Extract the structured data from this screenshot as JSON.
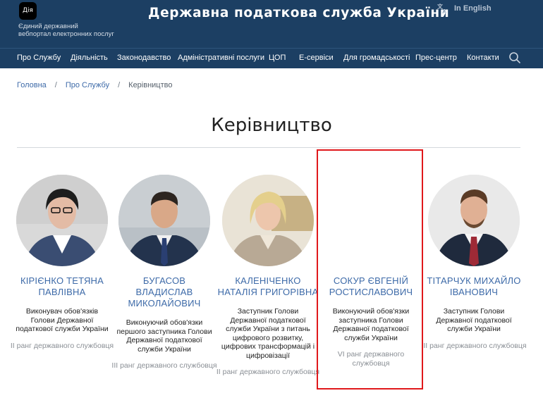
{
  "header": {
    "diia_logo": "Дія",
    "diia_line1": "Єдиний державний",
    "diia_line2": "вебпортал електронних послуг",
    "title": "Державна податкова служба України",
    "lang_link": "In English"
  },
  "nav": {
    "items": [
      {
        "label": "Про Службу"
      },
      {
        "label": "Діяльність"
      },
      {
        "label": "Законодавство"
      },
      {
        "label": "Адміністративні послуги"
      },
      {
        "label": "ЦОП"
      },
      {
        "label": "Е-сервіси"
      },
      {
        "label": "Для громадськості"
      },
      {
        "label": "Прес-центр"
      },
      {
        "label": "Контакти"
      }
    ]
  },
  "breadcrumb": {
    "items": [
      "Головна",
      "Про Службу"
    ],
    "separator": "/",
    "current": "Керівництво"
  },
  "page": {
    "title": "Керівництво"
  },
  "people": [
    {
      "name_line1": "КІРІЄНКО ТЕТЯНА",
      "name_line2": "ПАВЛІВНА",
      "name_line3": "",
      "role": "Виконувач обов'язків Голови Державної податкової служби України",
      "rank": "ІІ ранг державного службовця"
    },
    {
      "name_line1": "БУГАСОВ",
      "name_line2": "ВЛАДИСЛАВ",
      "name_line3": "МИКОЛАЙОВИЧ",
      "role": "Виконуючий обов'язки першого заступника Голови Державної податкової служби України",
      "rank": "ІІІ ранг державного службовця"
    },
    {
      "name_line1": "КАЛЕНІЧЕНКО",
      "name_line2": "НАТАЛІЯ ГРИГОРІВНА",
      "name_line3": "",
      "role": "Заступник Голови Державної податкової служби України з питань цифрового розвитку, цифрових трансформацій і цифровізації",
      "rank": "ІІ ранг державного службовця"
    },
    {
      "name_line1": "СОКУР ЄВГЕНІЙ",
      "name_line2": "РОСТИСЛАВОВИЧ",
      "name_line3": "",
      "role": "Виконуючий обов'язки заступника Голови Державної податкової служби України",
      "rank": "VI ранг державного службовця"
    },
    {
      "name_line1": "ТІТАРЧУК МИХАЙЛО",
      "name_line2": "ІВАНОВИЧ",
      "name_line3": "",
      "role": "Заступник Голови Державної податкової служби України",
      "rank": "ІІІ ранг державного службовця"
    }
  ],
  "colors": {
    "header_bg": "#1c3f63",
    "link": "#3d6aa8",
    "highlight": "#e0181b"
  }
}
